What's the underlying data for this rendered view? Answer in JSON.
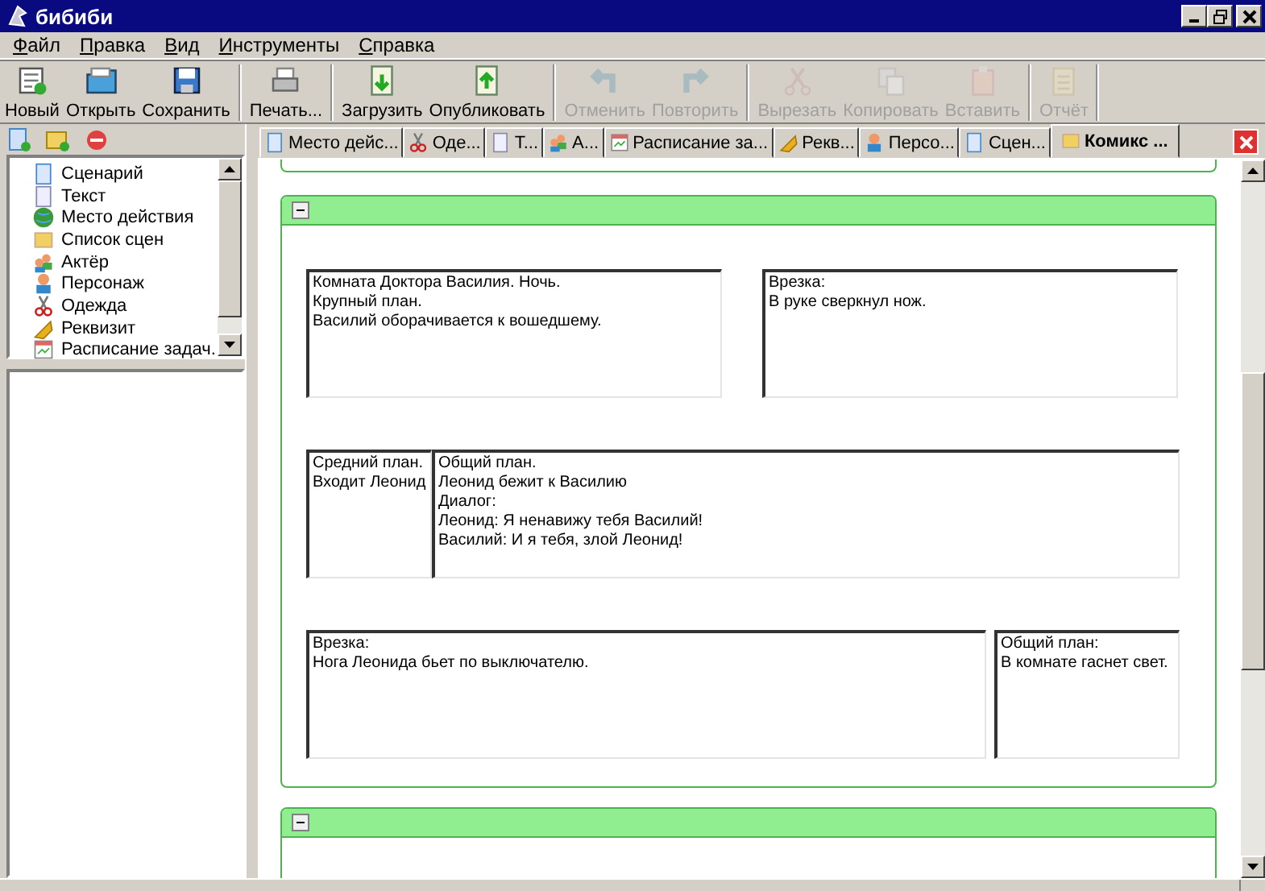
{
  "window": {
    "title": "бибиби"
  },
  "menu": [
    {
      "label": "Файл"
    },
    {
      "label": "Правка"
    },
    {
      "label": "Вид"
    },
    {
      "label": "Инструменты"
    },
    {
      "label": "Справка"
    }
  ],
  "toolbar": {
    "groups": [
      [
        {
          "label": "Новый",
          "disabled": false
        },
        {
          "label": "Открыть",
          "disabled": false
        },
        {
          "label": "Сохранить",
          "disabled": false
        }
      ],
      [
        {
          "label": "Печать...",
          "disabled": false
        }
      ],
      [
        {
          "label": "Загрузить",
          "disabled": false
        },
        {
          "label": "Опубликовать",
          "disabled": false
        }
      ],
      [
        {
          "label": "Отменить",
          "disabled": true
        },
        {
          "label": "Повторить",
          "disabled": true
        }
      ],
      [
        {
          "label": "Вырезать",
          "disabled": true
        },
        {
          "label": "Копировать",
          "disabled": true
        },
        {
          "label": "Вставить",
          "disabled": true
        }
      ],
      [
        {
          "label": "Отчёт",
          "disabled": true
        }
      ]
    ]
  },
  "sidebar": {
    "tree": [
      {
        "label": "Сценарий"
      },
      {
        "label": "Текст"
      },
      {
        "label": "Место действия"
      },
      {
        "label": "Список сцен"
      },
      {
        "label": "Актёр"
      },
      {
        "label": "Персонаж"
      },
      {
        "label": "Одежда"
      },
      {
        "label": "Реквизит"
      },
      {
        "label": "Расписание задач."
      }
    ]
  },
  "tabs": [
    {
      "label": "Место дейс...",
      "selected": false
    },
    {
      "label": "Оде...",
      "selected": false
    },
    {
      "label": "Т...",
      "selected": false
    },
    {
      "label": "А...",
      "selected": false
    },
    {
      "label": "Расписание за...",
      "selected": false
    },
    {
      "label": "Рекв...",
      "selected": false
    },
    {
      "label": "Персо...",
      "selected": false
    },
    {
      "label": "Сцен...",
      "selected": false
    },
    {
      "label": "Комикс ...",
      "selected": true
    }
  ],
  "panels": [
    {
      "expanded": true,
      "rows": [
        {
          "frames": [
            {
              "text": "Комната Доктора Василия. Ночь.\nКрупный план.\nВасилий оборачивается к вошедшему."
            },
            {
              "text": "Врезка:\nВ руке сверкнул нож."
            }
          ]
        },
        {
          "frames": [
            {
              "text": "Средний план.\nВходит Леонид"
            },
            {
              "text": "Общий план.\nЛеонид бежит к Василию\nДиалог:\nЛеонид: Я ненавижу тебя Василий!\nВасилий: И я тебя, злой Леонид!"
            }
          ]
        },
        {
          "frames": [
            {
              "text": "Врезка:\nНога Леонида бьет по выключателю."
            },
            {
              "text": "Общий план:\nВ комнате гаснет свет."
            }
          ]
        }
      ]
    },
    {
      "expanded": true
    }
  ]
}
